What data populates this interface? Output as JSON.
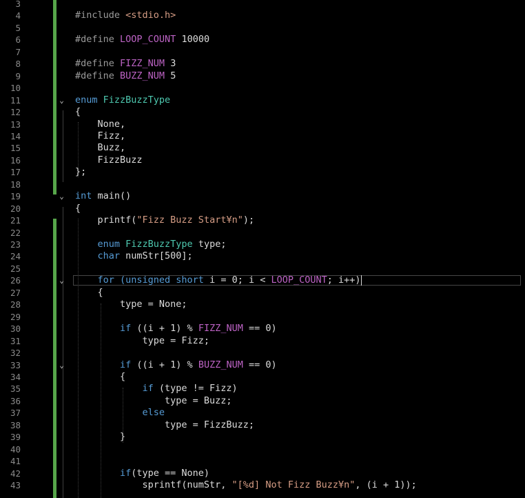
{
  "editor": {
    "colors": {
      "background": "#000000",
      "change_bar": "#57a64a",
      "line_number": "#8a8a8a",
      "keyword": "#569cd6",
      "type": "#4ec9b0",
      "macro": "#bd63c5",
      "string": "#d69d85",
      "preprocessor": "#9b9b9b"
    },
    "current_line": 26,
    "lines": [
      {
        "n": "3",
        "fold": "",
        "indent": 0,
        "tokens": []
      },
      {
        "n": "4",
        "fold": "",
        "indent": 0,
        "tokens": [
          {
            "c": "pp",
            "t": "#include "
          },
          {
            "c": "str",
            "t": "<stdio.h>"
          }
        ]
      },
      {
        "n": "5",
        "fold": "",
        "indent": 0,
        "tokens": []
      },
      {
        "n": "6",
        "fold": "",
        "indent": 0,
        "tokens": [
          {
            "c": "pp",
            "t": "#define "
          },
          {
            "c": "mac",
            "t": "LOOP_COUNT"
          },
          {
            "c": "txt",
            "t": " 10000"
          }
        ]
      },
      {
        "n": "7",
        "fold": "",
        "indent": 0,
        "tokens": []
      },
      {
        "n": "8",
        "fold": "",
        "indent": 0,
        "tokens": [
          {
            "c": "pp",
            "t": "#define "
          },
          {
            "c": "mac",
            "t": "FIZZ_NUM"
          },
          {
            "c": "txt",
            "t": " 3"
          }
        ]
      },
      {
        "n": "9",
        "fold": "",
        "indent": 0,
        "tokens": [
          {
            "c": "pp",
            "t": "#define "
          },
          {
            "c": "mac",
            "t": "BUZZ_NUM"
          },
          {
            "c": "txt",
            "t": " 5"
          }
        ]
      },
      {
        "n": "10",
        "fold": "",
        "indent": 0,
        "tokens": []
      },
      {
        "n": "11",
        "fold": "⌄",
        "indent": 0,
        "tokens": [
          {
            "c": "kw",
            "t": "enum "
          },
          {
            "c": "type",
            "t": "FizzBuzzType"
          }
        ]
      },
      {
        "n": "12",
        "fold": "",
        "indent": 0,
        "tokens": [
          {
            "c": "txt",
            "t": "{"
          }
        ]
      },
      {
        "n": "13",
        "fold": "",
        "indent": 1,
        "tokens": [
          {
            "c": "txt",
            "t": "None,"
          }
        ]
      },
      {
        "n": "14",
        "fold": "",
        "indent": 1,
        "tokens": [
          {
            "c": "txt",
            "t": "Fizz,"
          }
        ]
      },
      {
        "n": "15",
        "fold": "",
        "indent": 1,
        "tokens": [
          {
            "c": "txt",
            "t": "Buzz,"
          }
        ]
      },
      {
        "n": "16",
        "fold": "",
        "indent": 1,
        "tokens": [
          {
            "c": "txt",
            "t": "FizzBuzz"
          }
        ]
      },
      {
        "n": "17",
        "fold": "",
        "indent": 0,
        "tokens": [
          {
            "c": "txt",
            "t": "};"
          }
        ]
      },
      {
        "n": "18",
        "fold": "",
        "indent": 0,
        "tokens": []
      },
      {
        "n": "19",
        "fold": "⌄",
        "indent": 0,
        "tokens": [
          {
            "c": "kw",
            "t": "int "
          },
          {
            "c": "txt",
            "t": "main()"
          }
        ]
      },
      {
        "n": "20",
        "fold": "",
        "indent": 0,
        "tokens": [
          {
            "c": "txt",
            "t": "{"
          }
        ]
      },
      {
        "n": "21",
        "fold": "",
        "indent": 1,
        "tokens": [
          {
            "c": "txt",
            "t": "printf("
          },
          {
            "c": "str",
            "t": "\"Fizz Buzz Start¥n\""
          },
          {
            "c": "txt",
            "t": ");"
          }
        ]
      },
      {
        "n": "22",
        "fold": "",
        "indent": 0,
        "tokens": []
      },
      {
        "n": "23",
        "fold": "",
        "indent": 1,
        "tokens": [
          {
            "c": "kw",
            "t": "enum "
          },
          {
            "c": "type",
            "t": "FizzBuzzType"
          },
          {
            "c": "txt",
            "t": " type;"
          }
        ]
      },
      {
        "n": "24",
        "fold": "",
        "indent": 1,
        "tokens": [
          {
            "c": "kw",
            "t": "char "
          },
          {
            "c": "txt",
            "t": "numStr[500];"
          }
        ]
      },
      {
        "n": "25",
        "fold": "",
        "indent": 0,
        "tokens": []
      },
      {
        "n": "26",
        "fold": "⌄",
        "indent": 1,
        "tokens": [
          {
            "c": "kw",
            "t": "for ("
          },
          {
            "c": "kw",
            "t": "unsigned short"
          },
          {
            "c": "txt",
            "t": " i = 0; i < "
          },
          {
            "c": "mac",
            "t": "LOOP_COUNT"
          },
          {
            "c": "txt",
            "t": "; i++)"
          }
        ]
      },
      {
        "n": "27",
        "fold": "",
        "indent": 1,
        "tokens": [
          {
            "c": "txt",
            "t": "{"
          }
        ]
      },
      {
        "n": "28",
        "fold": "",
        "indent": 2,
        "tokens": [
          {
            "c": "txt",
            "t": "type = None;"
          }
        ]
      },
      {
        "n": "29",
        "fold": "",
        "indent": 0,
        "tokens": []
      },
      {
        "n": "30",
        "fold": "",
        "indent": 2,
        "tokens": [
          {
            "c": "kw",
            "t": "if"
          },
          {
            "c": "txt",
            "t": " ((i + 1) % "
          },
          {
            "c": "mac",
            "t": "FIZZ_NUM"
          },
          {
            "c": "txt",
            "t": " == 0)"
          }
        ]
      },
      {
        "n": "31",
        "fold": "",
        "indent": 3,
        "tokens": [
          {
            "c": "txt",
            "t": "type = Fizz;"
          }
        ]
      },
      {
        "n": "32",
        "fold": "",
        "indent": 0,
        "tokens": []
      },
      {
        "n": "33",
        "fold": "⌄",
        "indent": 2,
        "tokens": [
          {
            "c": "kw",
            "t": "if"
          },
          {
            "c": "txt",
            "t": " ((i + 1) % "
          },
          {
            "c": "mac",
            "t": "BUZZ_NUM"
          },
          {
            "c": "txt",
            "t": " == 0)"
          }
        ]
      },
      {
        "n": "34",
        "fold": "",
        "indent": 2,
        "tokens": [
          {
            "c": "txt",
            "t": "{"
          }
        ]
      },
      {
        "n": "35",
        "fold": "",
        "indent": 3,
        "tokens": [
          {
            "c": "kw",
            "t": "if"
          },
          {
            "c": "txt",
            "t": " (type != Fizz)"
          }
        ]
      },
      {
        "n": "36",
        "fold": "",
        "indent": 4,
        "tokens": [
          {
            "c": "txt",
            "t": "type = Buzz;"
          }
        ]
      },
      {
        "n": "37",
        "fold": "",
        "indent": 3,
        "tokens": [
          {
            "c": "kw",
            "t": "else"
          }
        ]
      },
      {
        "n": "38",
        "fold": "",
        "indent": 4,
        "tokens": [
          {
            "c": "txt",
            "t": "type = FizzBuzz;"
          }
        ]
      },
      {
        "n": "39",
        "fold": "",
        "indent": 2,
        "tokens": [
          {
            "c": "txt",
            "t": "}"
          }
        ]
      },
      {
        "n": "40",
        "fold": "",
        "indent": 0,
        "tokens": []
      },
      {
        "n": "41",
        "fold": "",
        "indent": 0,
        "tokens": []
      },
      {
        "n": "42",
        "fold": "",
        "indent": 2,
        "tokens": [
          {
            "c": "kw",
            "t": "if"
          },
          {
            "c": "txt",
            "t": "(type == None)"
          }
        ]
      },
      {
        "n": "43",
        "fold": "",
        "indent": 3,
        "tokens": [
          {
            "c": "txt",
            "t": "sprintf(numStr, "
          },
          {
            "c": "str",
            "t": "\"[%d] Not Fizz Buzz¥n\""
          },
          {
            "c": "txt",
            "t": ", (i + 1));"
          }
        ]
      }
    ]
  }
}
